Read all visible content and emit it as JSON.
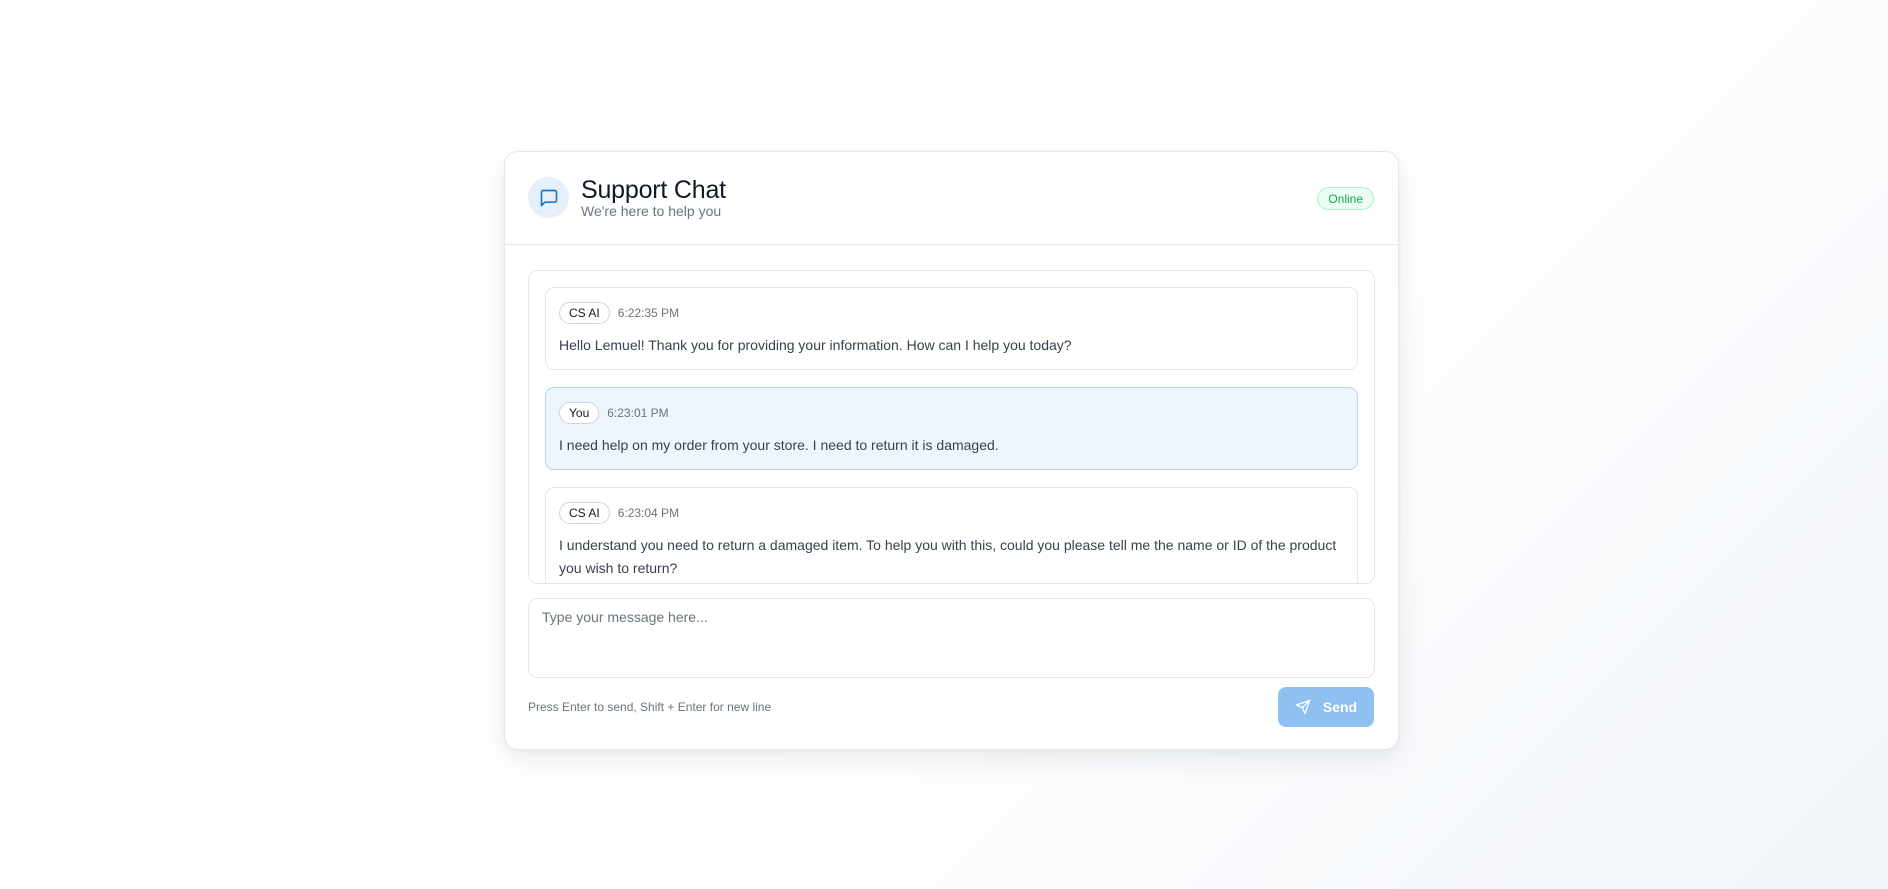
{
  "header": {
    "title": "Support Chat",
    "subtitle": "We're here to help you",
    "status": "Online",
    "icon": "chat-bubble-icon"
  },
  "messages": [
    {
      "sender": "CS AI",
      "time": "6:22:35 PM",
      "text": "Hello Lemuel! Thank you for providing your information. How can I help you today?",
      "role": "agent"
    },
    {
      "sender": "You",
      "time": "6:23:01 PM",
      "text": "I need help on my order from your store. I need to return it is damaged.",
      "role": "user"
    },
    {
      "sender": "CS AI",
      "time": "6:23:04 PM",
      "text": "I understand you need to return a damaged item. To help you with this, could you please tell me the name or ID of the product you wish to return?",
      "role": "agent"
    }
  ],
  "composer": {
    "placeholder": "Type your message here...",
    "value": "",
    "hint": "Press Enter to send, Shift + Enter for new line",
    "send_label": "Send",
    "send_icon": "paper-plane-icon"
  },
  "colors": {
    "accent": "#1877d2",
    "send_button": "#8ec1f2",
    "online": "#16a34a",
    "user_bubble": "#eef5fd"
  }
}
